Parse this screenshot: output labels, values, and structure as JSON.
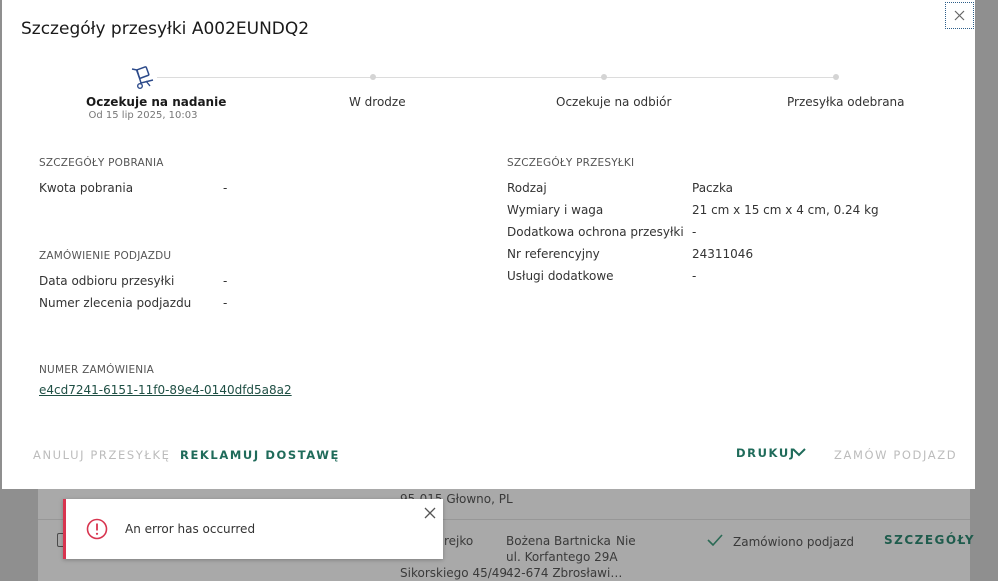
{
  "modal": {
    "title": "Szczegóły przesyłki A002EUNDQ2",
    "close_icon": "close-icon"
  },
  "stepper": {
    "steps": [
      {
        "label": "Oczekuje na nadanie",
        "sub": "Od 15 lip 2025, 10:03",
        "active": true,
        "icon": "hand-truck-icon"
      },
      {
        "label": "W drodze",
        "active": false
      },
      {
        "label": "Oczekuje na odbiór",
        "active": false
      },
      {
        "label": "Przesyłka odebrana",
        "active": false
      }
    ]
  },
  "cod": {
    "heading": "SZCZEGÓŁY POBRANIA",
    "rows": [
      {
        "label": "Kwota pobrania",
        "value": "-"
      }
    ]
  },
  "pickup": {
    "heading": "ZAMÓWIENIE PODJAZDU",
    "rows": [
      {
        "label": "Data odbioru przesyłki",
        "value": "-"
      },
      {
        "label": "Numer zlecenia podjazdu",
        "value": "-"
      }
    ]
  },
  "order": {
    "heading": "NUMER ZAMÓWIENIA",
    "link": "e4cd7241-6151-11f0-89e4-0140dfd5a8a2"
  },
  "shipment": {
    "heading": "SZCZEGÓŁY PRZESYŁKI",
    "rows": [
      {
        "label": "Rodzaj",
        "value": "Paczka"
      },
      {
        "label": "Wymiary i waga",
        "value": "21 cm x 15 cm x 4 cm, 0.24 kg"
      },
      {
        "label": "Dodatkowa ochrona przesyłki",
        "value": "-"
      },
      {
        "label": "Nr referencyjny",
        "value": "24311046"
      },
      {
        "label": "Usługi dodatkowe",
        "value": "-"
      }
    ]
  },
  "actions": {
    "cancel": "ANULUJ PRZESYŁKĘ",
    "complain": "REKLAMUJ DOSTAWĘ",
    "print": "DRUKUJ",
    "order_pickup": "ZAMÓW PODJAZD"
  },
  "toast": {
    "message": "An error has occurred",
    "icon": "error-icon",
    "accent": "#d8344f"
  },
  "background": {
    "addr_top": "95-015 Głowno, PL",
    "sender_line1": "rejko",
    "sender_line2": "Sikorskiego 45/49",
    "recipient_name": "Bożena Bartnicka",
    "recipient_street": "ul. Korfantego 29A",
    "recipient_city": "42-674 Zbrosławi…",
    "cod": "Nie",
    "status": "Zamówiono podjazd",
    "details_link": "SZCZEGÓŁY"
  },
  "colors": {
    "accent": "#1f6b5a",
    "error": "#d8344f",
    "overlay": "#8f8f8f"
  }
}
